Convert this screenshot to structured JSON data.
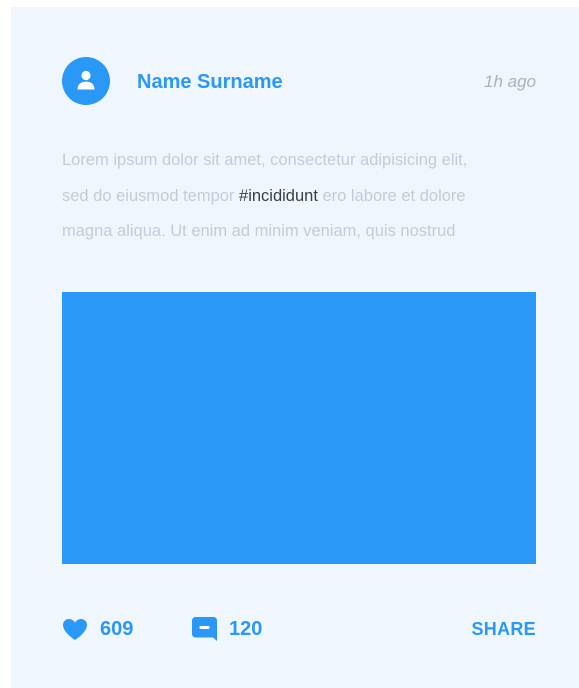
{
  "post": {
    "author_name": "Name Surname",
    "timestamp": "1h ago",
    "text_line1": "Lorem ipsum dolor sit amet, consectetur adipisicing elit,",
    "text_line2_before": "sed do eiusmod tempor ",
    "hashtag": "#incididunt",
    "text_line2_after": " ero labore et dolore",
    "text_line3": "magna aliqua. Ut enim ad minim veniam, quis nostrud"
  },
  "actions": {
    "likes": "609",
    "comments": "120",
    "share_label": "SHARE"
  },
  "icons": {
    "avatar": "user-icon",
    "like": "heart-icon",
    "comment": "comment-icon"
  },
  "colors": {
    "accent": "#2a98f7",
    "card_background": "#eff6fd",
    "muted_text": "#c4ccd4",
    "timestamp_text": "#a9b2bb",
    "hashtag_text": "#3b3f44"
  }
}
